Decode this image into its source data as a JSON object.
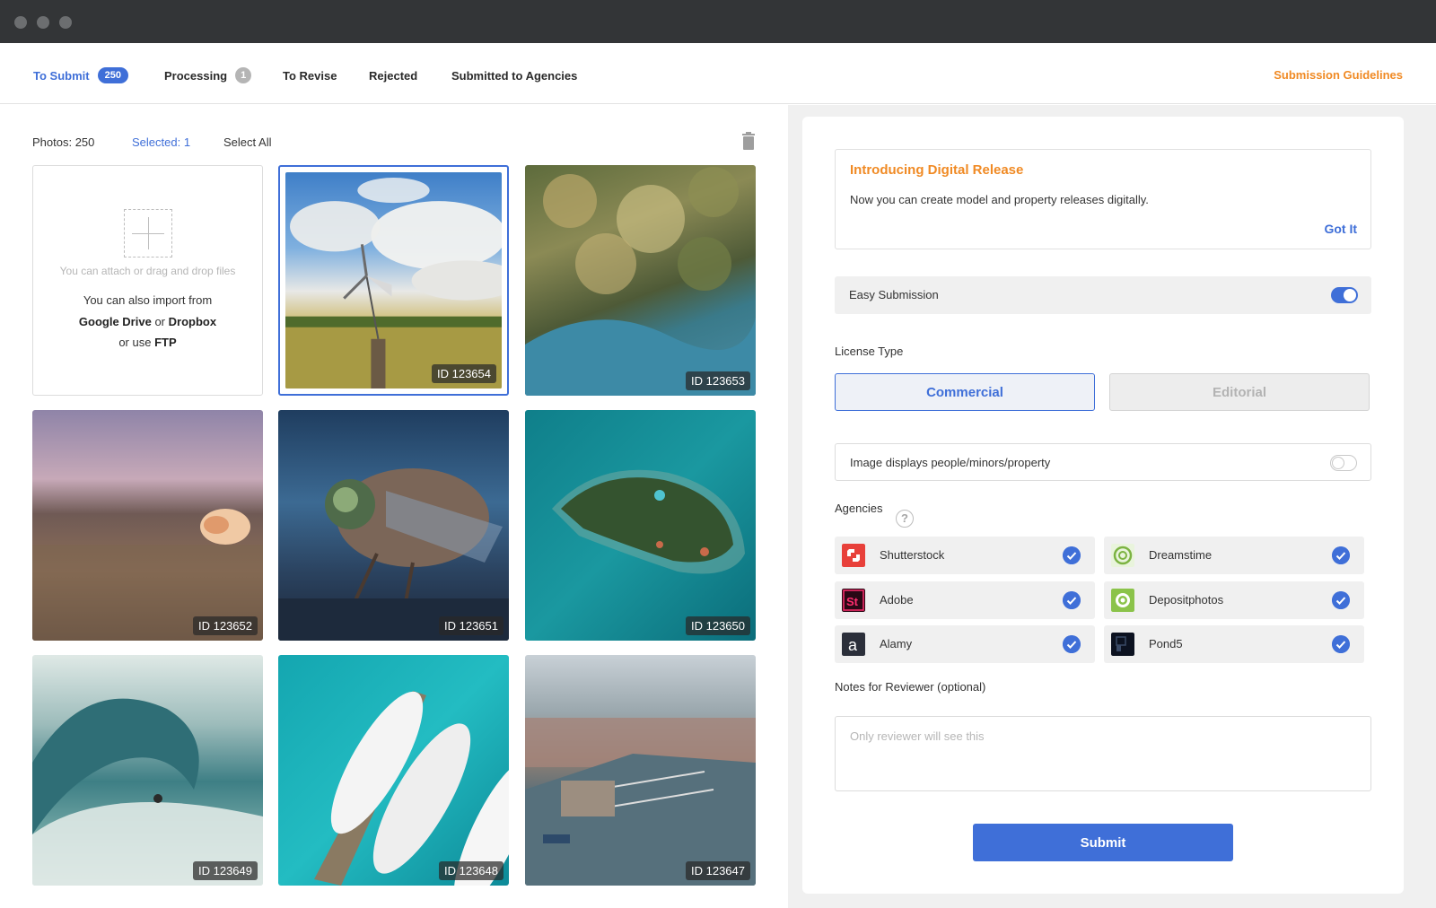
{
  "window": {
    "controls": [
      "close",
      "minimize",
      "maximize"
    ]
  },
  "tabs": [
    {
      "label": "To Submit",
      "badge": "250",
      "active": true
    },
    {
      "label": "Processing",
      "badge": "1",
      "active": false
    },
    {
      "label": "To Revise",
      "badge": "",
      "active": false
    },
    {
      "label": "Rejected",
      "badge": "",
      "active": false
    },
    {
      "label": "Submitted to Agencies",
      "badge": "",
      "active": false
    }
  ],
  "guidelines_label": "Submission Guidelines",
  "toolbar": {
    "photos": "Photos: 250",
    "selected": "Selected: 1",
    "select_all": "Select All",
    "delete_icon": "trash-icon"
  },
  "upload": {
    "hint": "You can attach or drag and drop files",
    "line1": "You can also import from",
    "google": "Google Drive",
    "or": "or",
    "dropbox": "Dropbox",
    "or_use": "or use",
    "ftp": "FTP"
  },
  "photos": [
    {
      "id": "ID 123654",
      "selected": true,
      "scene": "windmill-field"
    },
    {
      "id": "ID 123653",
      "selected": false,
      "scene": "aerial-forest"
    },
    {
      "id": "ID 123652",
      "selected": false,
      "scene": "pebble-beach-shell"
    },
    {
      "id": "ID 123651",
      "selected": false,
      "scene": "fly-macro"
    },
    {
      "id": "ID 123650",
      "selected": false,
      "scene": "island-aerial"
    },
    {
      "id": "ID 123649",
      "selected": false,
      "scene": "surf-wave"
    },
    {
      "id": "ID 123648",
      "selected": false,
      "scene": "yachts-dock"
    },
    {
      "id": "ID 123647",
      "selected": false,
      "scene": "harbor-town"
    }
  ],
  "intro": {
    "title": "Introducing Digital Release",
    "text": "Now you can create model and property releases digitally.",
    "button": "Got It"
  },
  "easy_submission": {
    "label": "Easy Submission",
    "on": true
  },
  "license": {
    "label": "License Type",
    "options": [
      "Commercial",
      "Editorial"
    ],
    "selected": "Commercial"
  },
  "people_toggle": {
    "label": "Image displays people/minors/property",
    "on": false
  },
  "agencies": {
    "label": "Agencies",
    "help_icon": "question-icon",
    "items": [
      {
        "name": "Shutterstock",
        "checked": true,
        "color": "#e8403a"
      },
      {
        "name": "Dreamstime",
        "checked": true,
        "color": "#7cb342"
      },
      {
        "name": "Adobe",
        "checked": true,
        "color": "#ff2d6f"
      },
      {
        "name": "Depositphotos",
        "checked": true,
        "color": "#8bc34a"
      },
      {
        "name": "Alamy",
        "checked": true,
        "color": "#2b2f3a"
      },
      {
        "name": "Pond5",
        "checked": true,
        "color": "#0c1220"
      }
    ]
  },
  "notes": {
    "label": "Notes for Reviewer (optional)",
    "placeholder": "Only reviewer will see this",
    "value": ""
  },
  "submit_label": "Submit",
  "colors": {
    "accent": "#3f6fd8",
    "orange": "#f08a24"
  }
}
